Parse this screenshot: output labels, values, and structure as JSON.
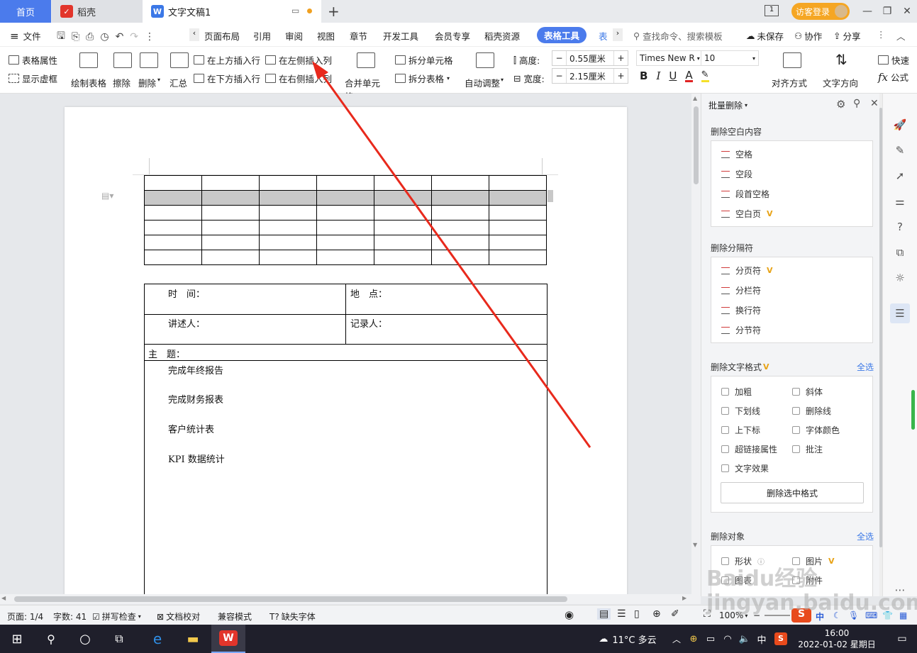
{
  "titlebar": {
    "tab_home": "首页",
    "tab_daoke": "稻壳",
    "tab_doc": "文字文稿1",
    "visitor_login": "访客登录"
  },
  "menubar": {
    "file": "文件",
    "items": [
      "页面布局",
      "引用",
      "审阅",
      "视图",
      "章节",
      "开发工具",
      "会员专享",
      "稻壳资源"
    ],
    "active_tab": "表格工具",
    "next_tab": "表",
    "search_placeholder": "查找命令、搜索模板",
    "unsaved": "未保存",
    "collab": "协作",
    "share": "分享"
  },
  "ribbon": {
    "table_props": "表格属性",
    "show_gridlines": "显示虚框",
    "draw_table": "绘制表格",
    "erase": "擦除",
    "delete": "删除",
    "summary": "汇总",
    "insert_row_above": "在上方插入行",
    "insert_row_below": "在下方插入行",
    "insert_col_left": "在左侧插入列",
    "insert_col_right": "在右侧插入列",
    "merge_cells": "合并单元格",
    "split_cells": "拆分单元格",
    "split_table": "拆分表格",
    "auto_adjust": "自动调整",
    "height_label": "高度:",
    "height_value": "0.55厘米",
    "width_label": "宽度:",
    "width_value": "2.15厘米",
    "font_name": "Times New R",
    "font_size": "10",
    "align": "对齐方式",
    "text_dir": "文字方向",
    "quick": "快速",
    "formula": "公式"
  },
  "document": {
    "grid_rows": 6,
    "grid_cols": 7,
    "selected_row": 2,
    "time_label": "时　间：",
    "place_label": "地　点：",
    "speaker_label": "讲述人：",
    "recorder_label": "记录人：",
    "topic_label": "主　题：",
    "content_lines": [
      "完成年终报告",
      "完成财务报表",
      "客户统计表",
      "KPI 数据统计"
    ]
  },
  "panel": {
    "header": "批量删除",
    "sec_blank": "删除空白内容",
    "blank_items": [
      "空格",
      "空段",
      "段首空格",
      "空白页"
    ],
    "sec_sep": "删除分隔符",
    "sep_items": [
      "分页符",
      "分栏符",
      "换行符",
      "分节符"
    ],
    "sec_format": "删除文字格式",
    "select_all": "全选",
    "format_left": [
      "加粗",
      "下划线",
      "上下标",
      "超链接属性",
      "文字效果"
    ],
    "format_right": [
      "斜体",
      "删除线",
      "字体颜色",
      "批注"
    ],
    "delete_format_btn": "删除选中格式",
    "sec_object": "删除对象",
    "object_left": [
      "形状",
      "图表"
    ],
    "object_right": [
      "图片",
      "附件"
    ],
    "vip": "V"
  },
  "status": {
    "page": "页面: 1/4",
    "words": "字数: 41",
    "spell": "拼写检查",
    "proof": "文档校对",
    "compat": "兼容模式",
    "missing_font": "缺失字体",
    "zoom": "100%"
  },
  "taskbar": {
    "weather": "11°C 多云",
    "ime": "中",
    "time": "16:00",
    "date": "2022-01-02 星期日"
  },
  "watermark": "Baidu经验 jingyan.baidu.com",
  "colors": {
    "accent": "#4b7bec",
    "annotation_arrow": "#e8291c",
    "vip": "#e8a317",
    "visitor_btn": "#f5a623"
  }
}
